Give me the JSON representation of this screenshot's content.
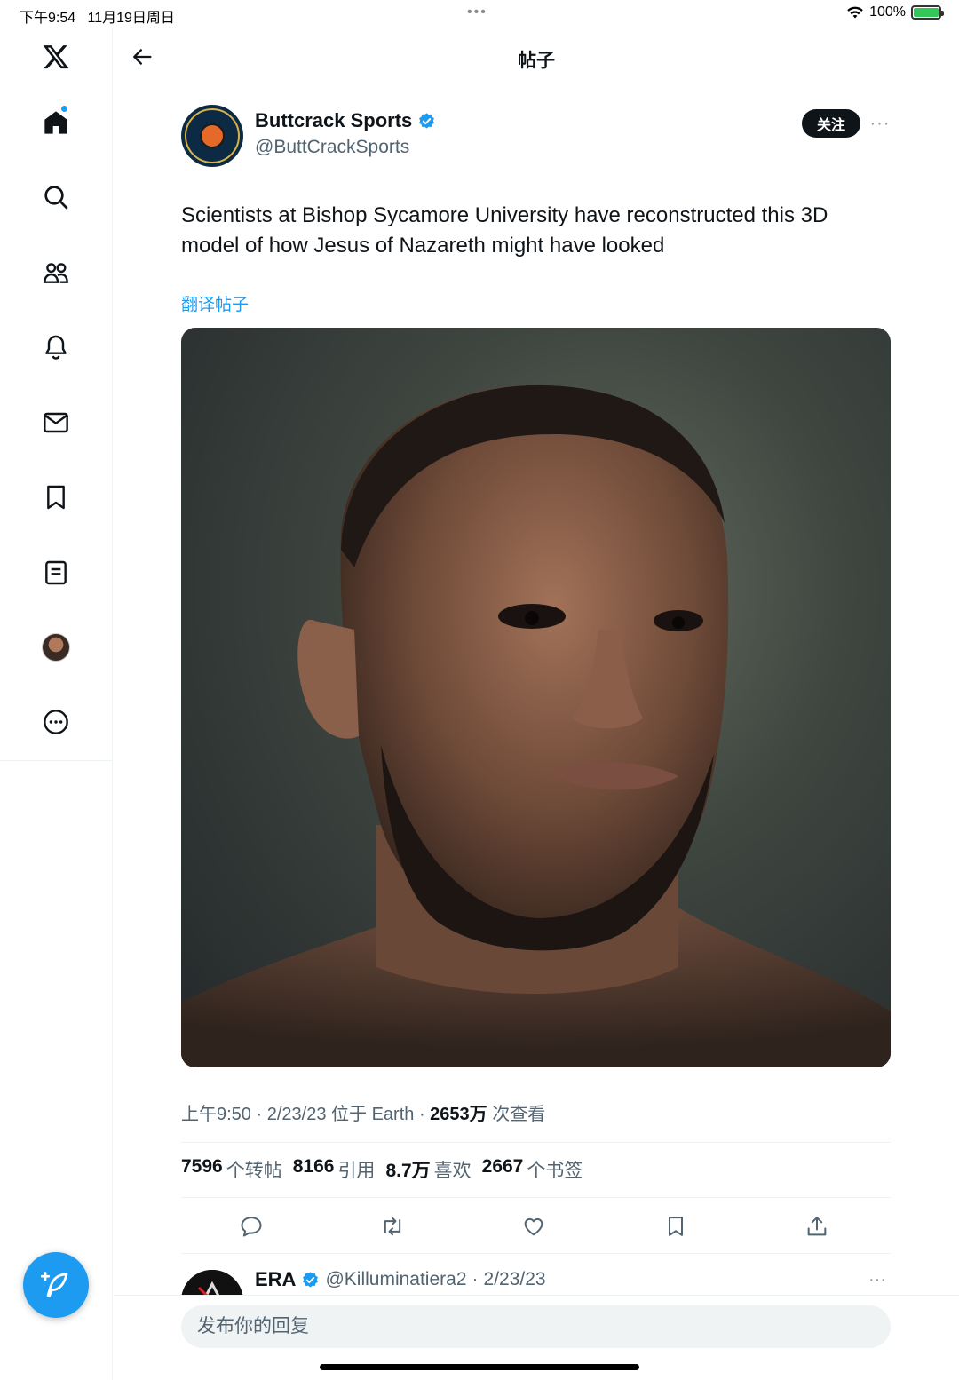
{
  "status_bar": {
    "time": "下午9:54",
    "date": "11月19日周日",
    "battery": "100%",
    "battery_level": 1.0
  },
  "sidebar": {
    "items": [
      {
        "icon": "x-logo-icon"
      },
      {
        "icon": "home-icon",
        "has_notification": true
      },
      {
        "icon": "search-icon"
      },
      {
        "icon": "communities-icon"
      },
      {
        "icon": "bell-icon"
      },
      {
        "icon": "mail-icon"
      },
      {
        "icon": "bookmark-icon"
      },
      {
        "icon": "lists-icon"
      },
      {
        "icon": "profile-avatar"
      },
      {
        "icon": "more-circle-icon"
      }
    ],
    "compose_icon": "feather-plus-icon"
  },
  "header": {
    "title": "帖子",
    "back_icon": "arrow-left-icon"
  },
  "tweet": {
    "author_name": "Buttcrack Sports",
    "author_handle": "@ButtCrackSports",
    "follow_label": "关注",
    "more_label": "···",
    "text": "Scientists at Bishop Sycamore University have reconstructed this 3D model of how Jesus of Nazareth might have looked",
    "translate_label": "翻译帖子",
    "meta": {
      "time": "上午9:50",
      "date": "2/23/23",
      "location_prefix": "位于",
      "location": "Earth",
      "views_num": "2653万",
      "views_label": "次查看"
    },
    "stats": [
      {
        "num": "7596",
        "label": "个转帖"
      },
      {
        "num": "8166",
        "label": "引用"
      },
      {
        "num": "8.7万",
        "label": "喜欢"
      },
      {
        "num": "2667",
        "label": "个书签"
      }
    ]
  },
  "reply_preview": {
    "name": "ERA",
    "handle": "@Killuminatiera2",
    "date": "2/23/23",
    "more_label": "···"
  },
  "composer": {
    "placeholder": "发布你的回复"
  },
  "colors": {
    "accent": "#1d9bf0",
    "text": "#0f1419",
    "secondary": "#536471",
    "border": "#eff3f4"
  }
}
